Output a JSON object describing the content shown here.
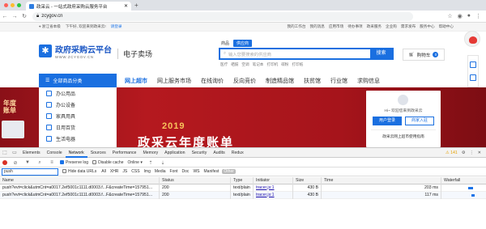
{
  "browser": {
    "tab_title": "政采云 - 一站式政府采购云服务平台",
    "new_tab": "+",
    "url": "zcygov.cn"
  },
  "site": {
    "topbar": {
      "location": "浙江省本级",
      "greeting": "下午好, 欢迎来到政采云!",
      "login_link": "请登录",
      "right_links": [
        "我的工作台",
        "我的消息",
        "应用市场",
        "待办事项",
        "政采服务",
        "企业购",
        "需求发布",
        "服务中心",
        "帮助中心"
      ]
    },
    "logo": {
      "name": "政府采购云平台",
      "domain": "WWW.ZCYGOV.CN"
    },
    "mall_label": "电子卖场",
    "search": {
      "scope_goods": "商品",
      "scope_supplier": "供应商",
      "placeholder": "输入您要搜索的供应商",
      "button": "搜索",
      "hot": [
        "医疗",
        "硒鼓",
        "空调",
        "笔记本",
        "打印机",
        "碳粉",
        "打印纸"
      ]
    },
    "cart": {
      "label": "购物车",
      "count": "0"
    },
    "nav": {
      "all_categories": "全部商品分类",
      "items": [
        "网上超市",
        "网上服务市场",
        "在线询价",
        "反向竞价",
        "制造精品馆",
        "扶贫馆",
        "行业馆",
        "求购信息"
      ]
    },
    "categories": [
      "办公用品",
      "办公设备",
      "家具用具",
      "日用百货",
      "生活电器"
    ],
    "banner": {
      "year": "2019",
      "title": "政采云年度账单",
      "tag_line1": "年度",
      "tag_line2": "账单"
    },
    "login_box": {
      "welcome": "Hi~ 欢迎您来到政采云",
      "user_login": "用户登录",
      "merchant_join": "商家入驻",
      "notice": "政采云网上超市使用指南"
    }
  },
  "devtools": {
    "tabs": [
      "Elements",
      "Console",
      "Network",
      "Sources",
      "Performance",
      "Memory",
      "Application",
      "Security",
      "Audits",
      "Redux"
    ],
    "warning_count": "141",
    "toolbar": {
      "preserve_log": "Preserve log",
      "disable_cache": "Disable cache",
      "throttle": "Online"
    },
    "filter": {
      "value": "push",
      "hide_data_urls": "Hide data URLs",
      "types": [
        "All",
        "XHR",
        "JS",
        "CSS",
        "Img",
        "Media",
        "Font",
        "Doc",
        "WS",
        "Manifest",
        "Other"
      ]
    },
    "columns": [
      "Name",
      "Status",
      "Type",
      "Initiator",
      "Size",
      "Time",
      "Waterfall"
    ],
    "rows": [
      {
        "name": "push?evt=click&utmCnt=a0017.2ef5001c1111.d0003.f...F&createTime=157951...",
        "status": "200",
        "type": "text/plain",
        "initiator": "tracer.js:1",
        "size": "430 B",
        "time": "203 ms"
      },
      {
        "name": "push?evt=click&utmCnt=a0017.2ef5001c1111.d0003.f...F&createTime=157951...",
        "status": "200",
        "type": "text/plain",
        "initiator": "tracer.js:1",
        "size": "430 B",
        "time": "117 ms"
      }
    ]
  }
}
